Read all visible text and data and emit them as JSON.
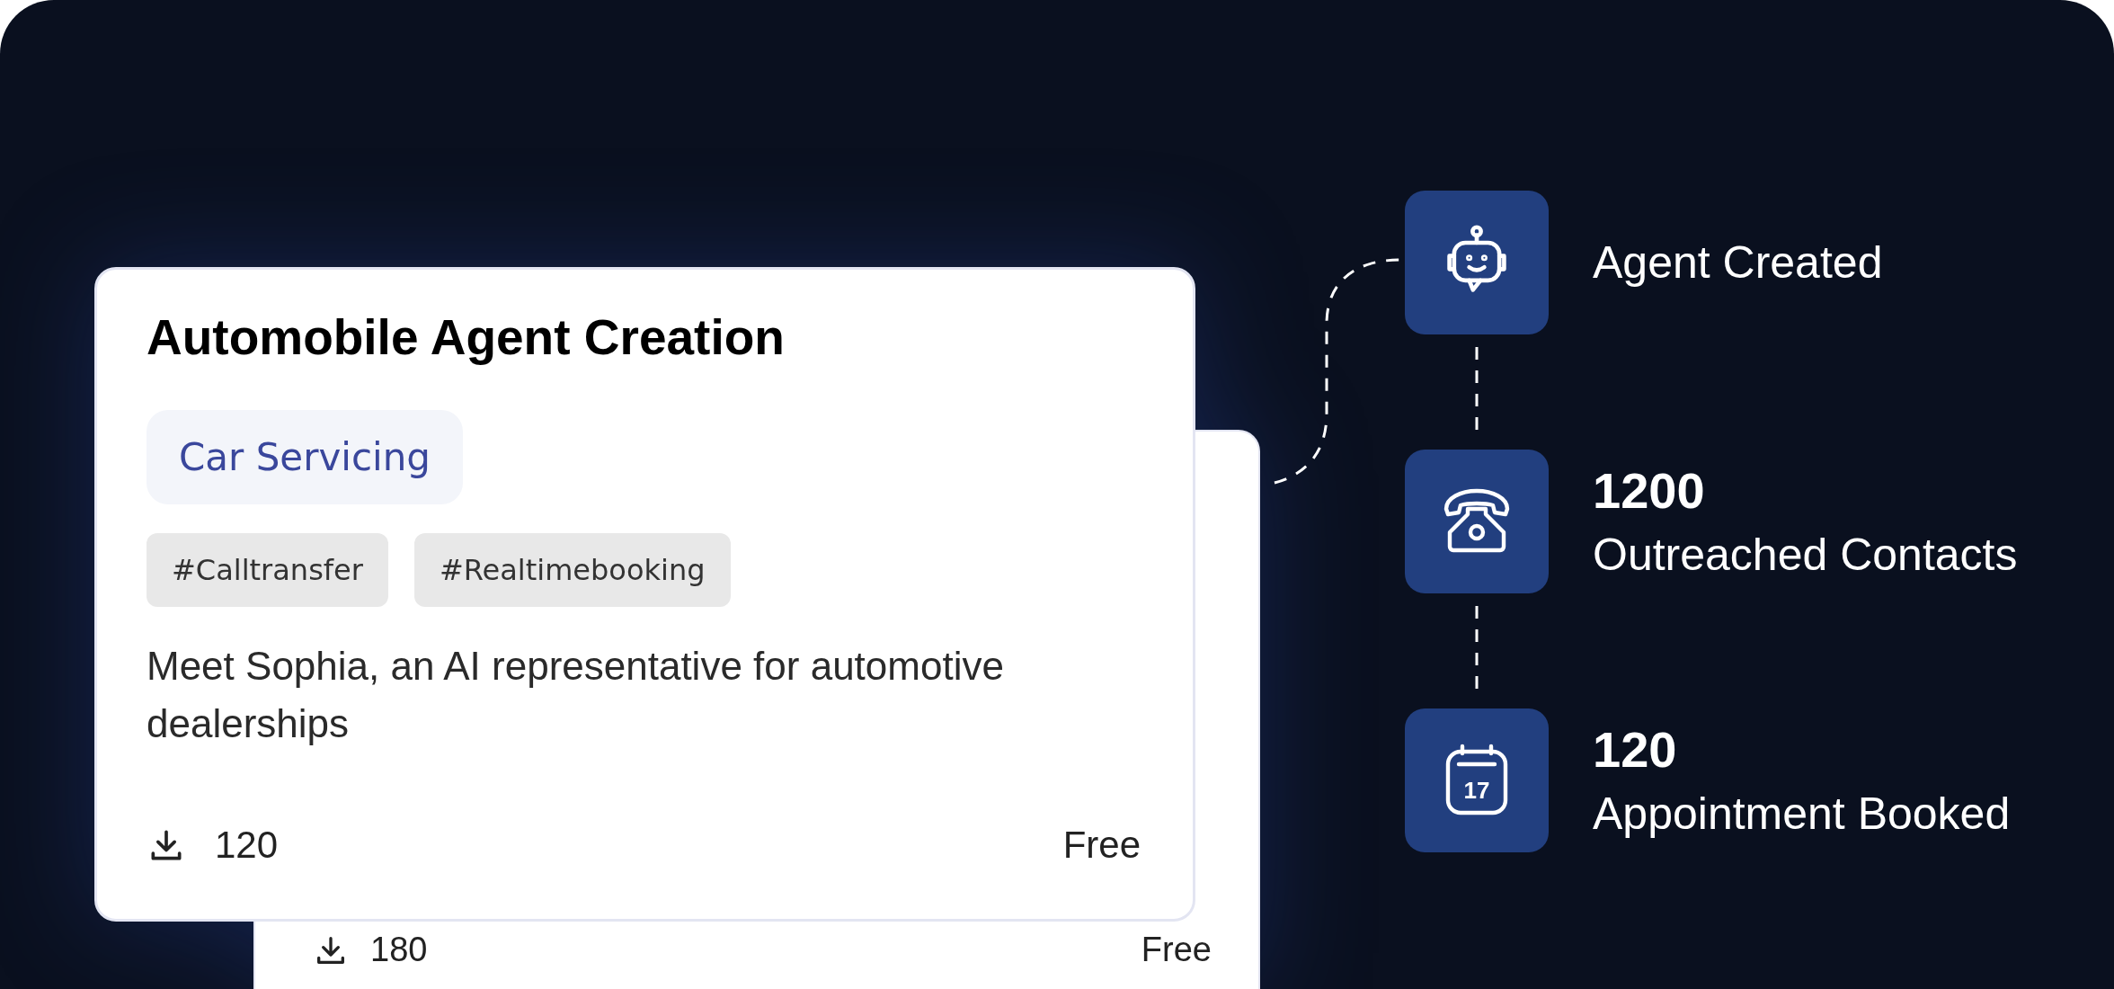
{
  "card": {
    "title": "Automobile Agent Creation",
    "category": "Car Servicing",
    "tags": [
      "#Calltransfer",
      "#Realtimebooking"
    ],
    "description": "Meet Sophia, an AI representative for automotive dealerships",
    "downloads": "120",
    "price": "Free"
  },
  "back_card": {
    "downloads": "180",
    "price": "Free"
  },
  "steps": [
    {
      "kind": "robot",
      "label": "Agent Created"
    },
    {
      "kind": "phone",
      "value": "1200",
      "label": "Outreached Contacts"
    },
    {
      "kind": "calendar",
      "value": "120",
      "label": "Appointment Booked",
      "day": "17"
    }
  ]
}
